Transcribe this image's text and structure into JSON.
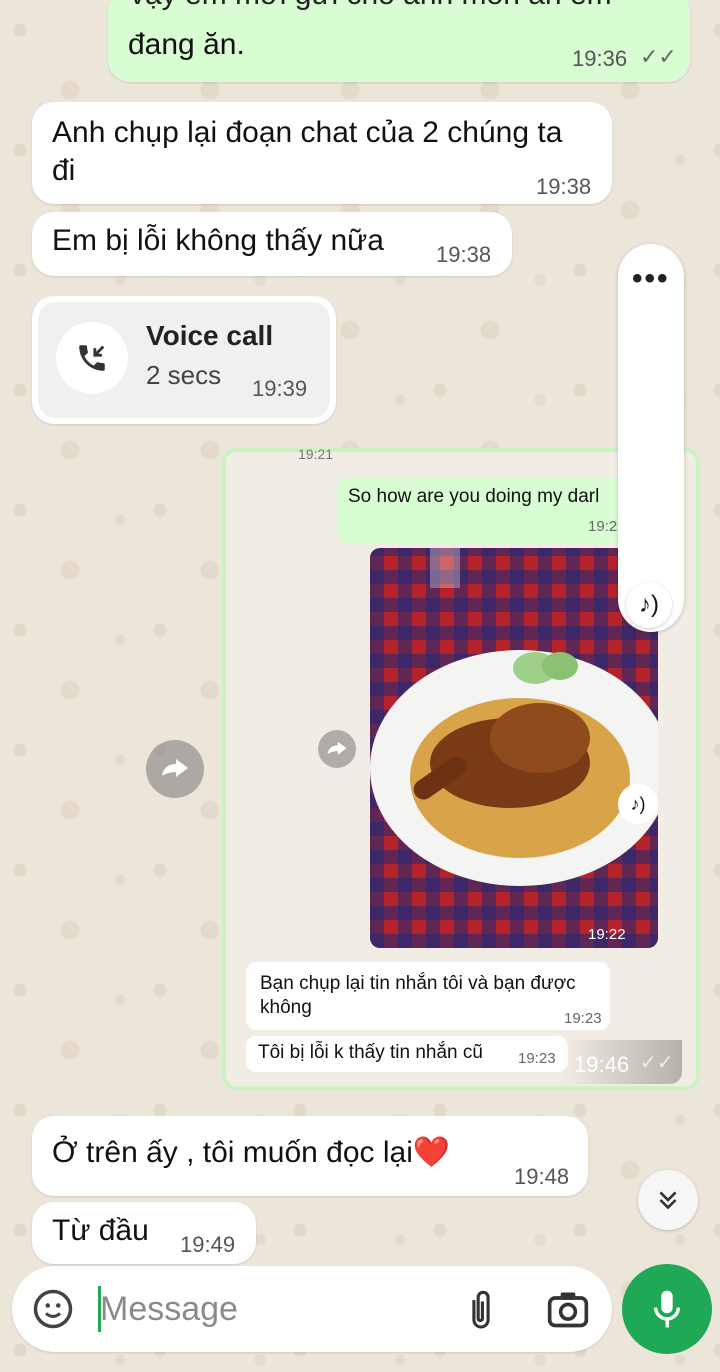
{
  "messages": {
    "m1": {
      "text_partial": "vậy em mới gửi cho anh món ăn em",
      "text": "đang ăn.",
      "time": "19:36",
      "ticks": "✓✓"
    },
    "m2": {
      "text": "Anh chụp lại đoạn chat của 2 chúng ta đi",
      "time": "19:38"
    },
    "m3": {
      "text": "Em bị lỗi không thấy nữa",
      "time": "19:38"
    },
    "call": {
      "title": "Voice call",
      "duration": "2 secs",
      "time": "19:39"
    },
    "screenshot": {
      "time": "19:46",
      "top_time": "19:21",
      "english_msg": "So how are you doing my darl",
      "english_time": "19:2",
      "photo_time": "19:22",
      "vn1": "Bạn chụp lại tin nhắn tôi và bạn được không",
      "vn1_time": "19:23",
      "vn2": "Tôi bị lỗi k thấy tin nhắn cũ",
      "vn2_time": "19:23"
    },
    "m5": {
      "text": "Ở trên ấy , tôi muốn đọc lại",
      "emoji": "❤️",
      "time": "19:48"
    },
    "m6": {
      "text": "Từ đầu",
      "time": "19:49"
    }
  },
  "composer": {
    "placeholder": "Message"
  },
  "colors": {
    "outgoing": "#d9fdd3",
    "incoming": "#ffffff",
    "accent": "#1fa855"
  },
  "icons": [
    "double-check-icon",
    "incoming-call-icon",
    "forward-icon",
    "more-icon",
    "audio-icon",
    "scroll-down-icon",
    "emoji-sticker-icon",
    "attach-icon",
    "camera-icon",
    "mic-icon"
  ]
}
